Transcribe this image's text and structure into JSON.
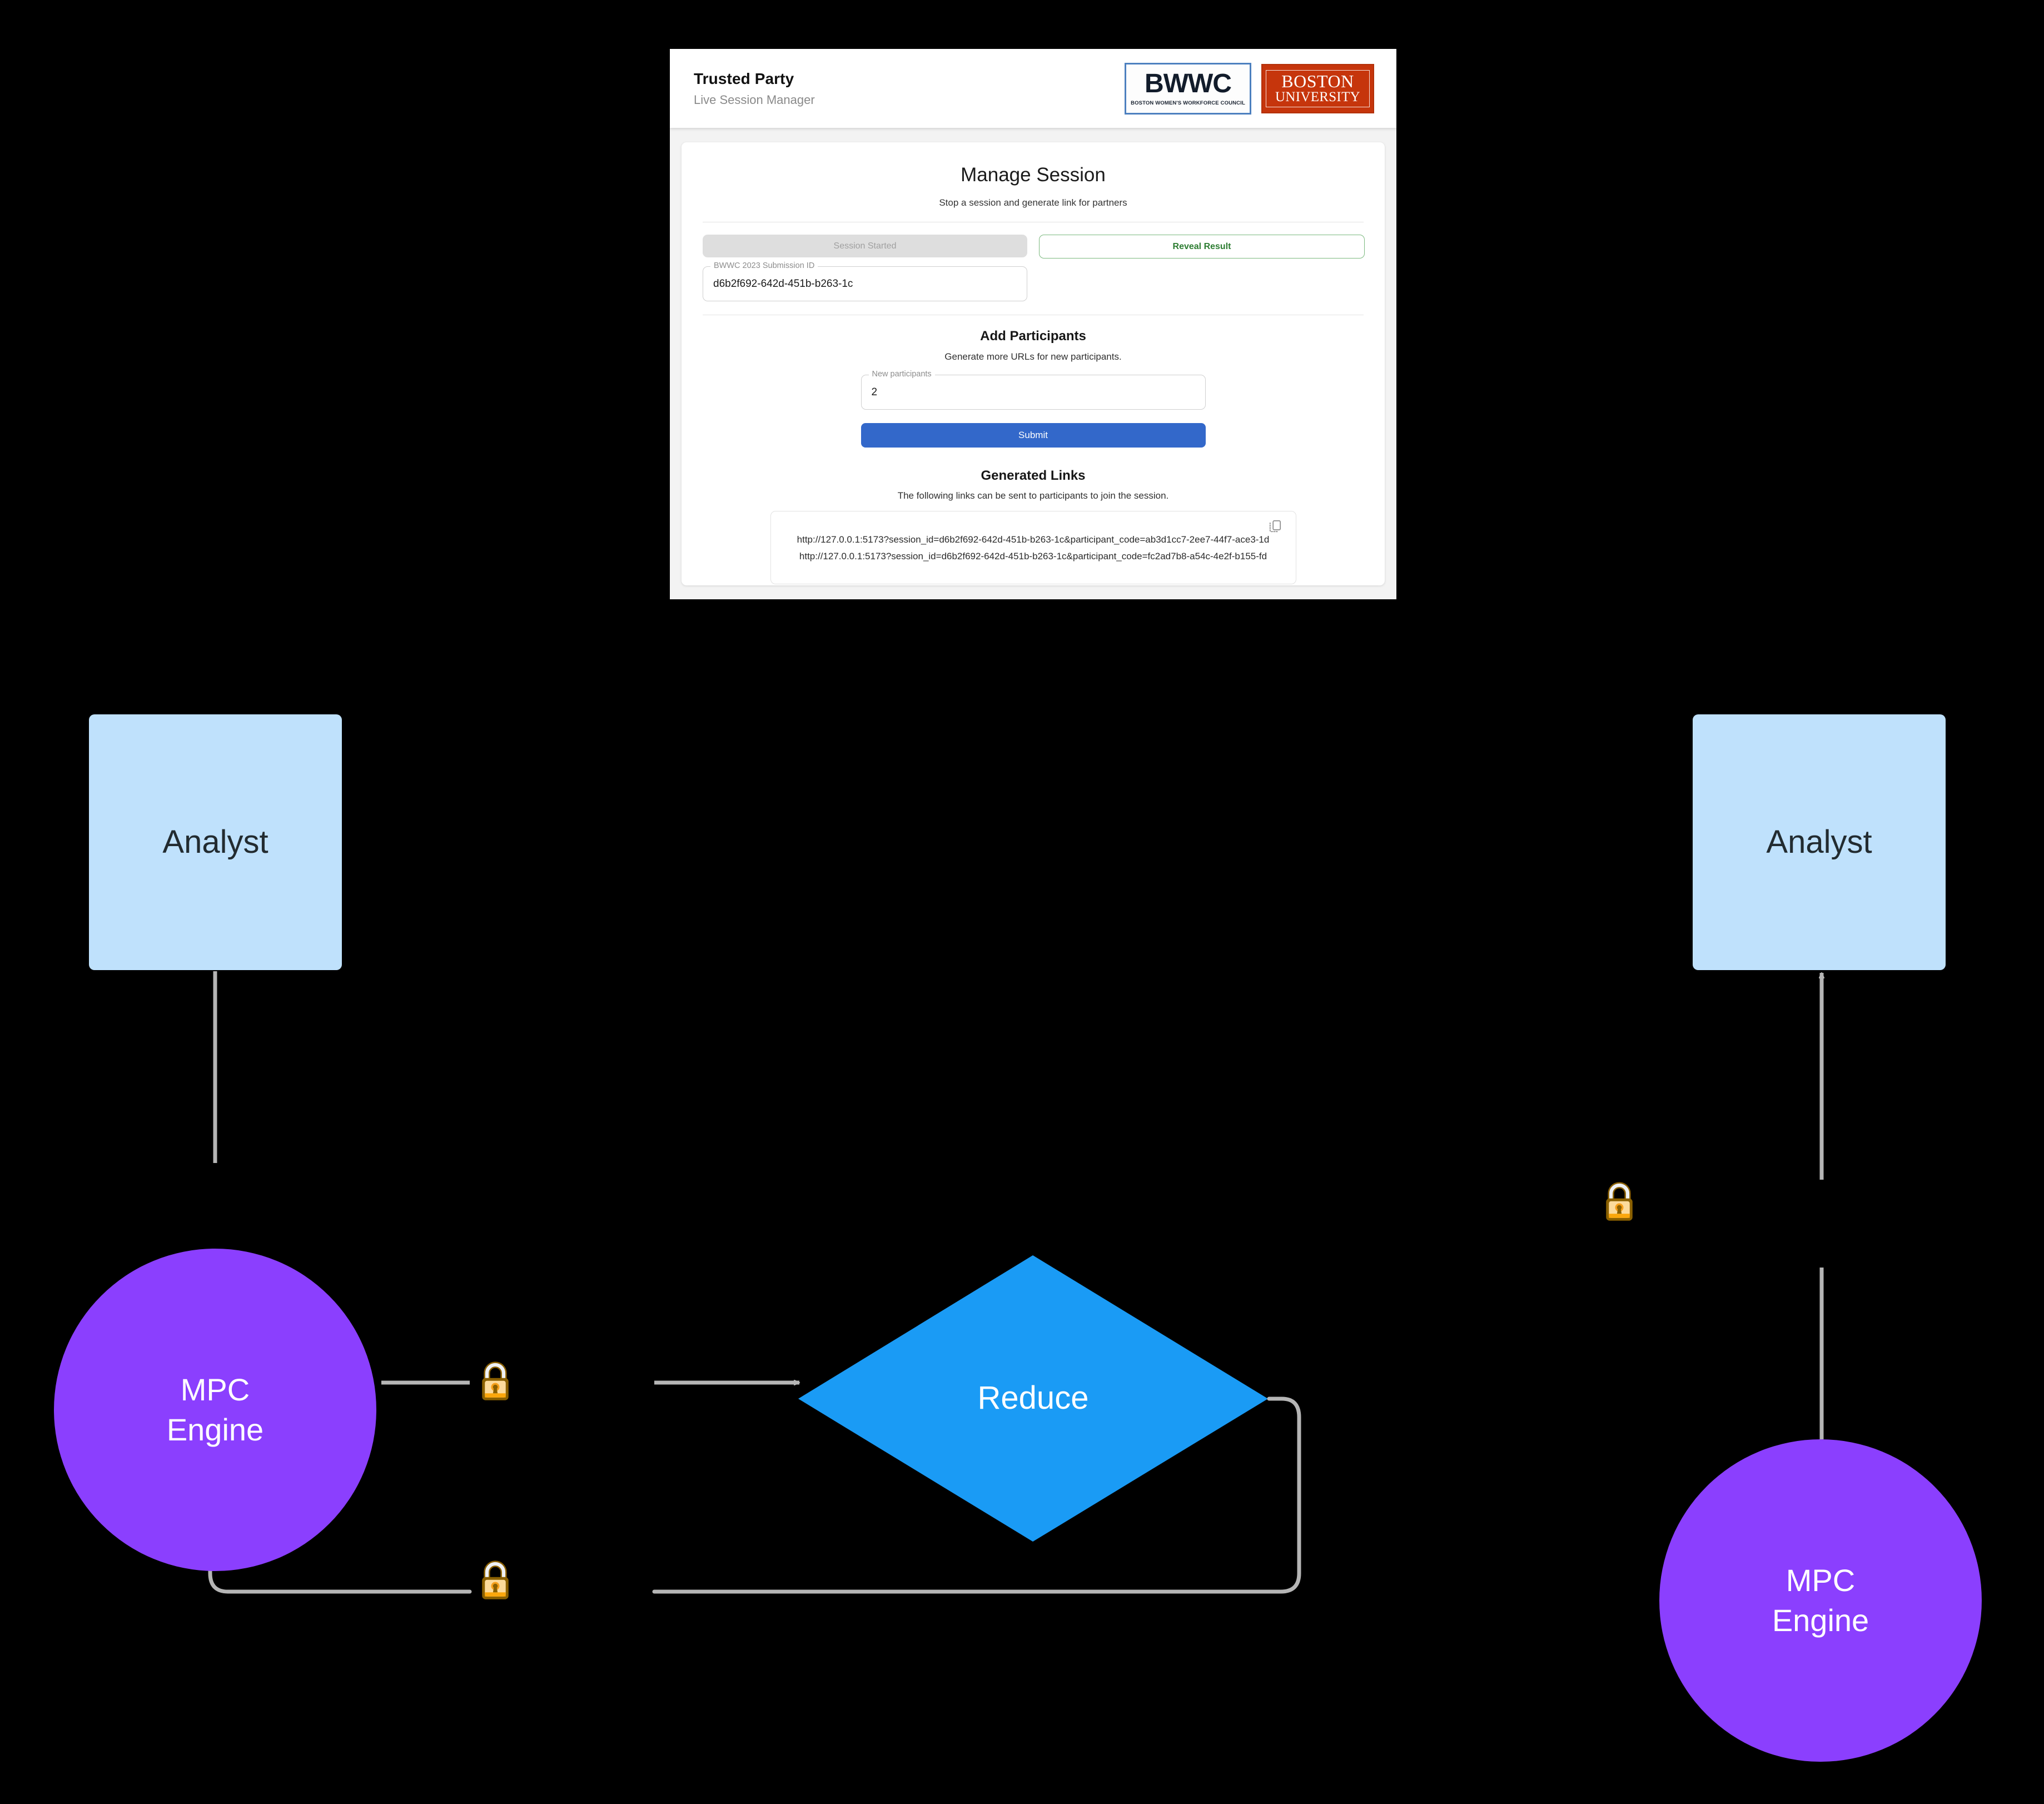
{
  "app": {
    "header": {
      "title": "Trusted Party",
      "subtitle": "Live Session Manager",
      "bwwc_logo": {
        "wordmark": "BWWC",
        "tagline": "BOSTON WOMEN'S WORKFORCE COUNCIL",
        "border_color": "#4d80bf"
      },
      "bu_logo": {
        "line1": "BOSTON",
        "line2": "UNIVERSITY",
        "background_color": "#c6350c"
      }
    },
    "manage_session": {
      "title": "Manage Session",
      "subtitle": "Stop a session and generate link for partners",
      "session_started_button": "Session Started",
      "reveal_result_button": "Reveal Result",
      "submission_id_label": "BWWC 2023 Submission ID",
      "submission_id_value": "d6b2f692-642d-451b-b263-1c"
    },
    "add_participants": {
      "title": "Add Participants",
      "subtitle": "Generate more URLs for new participants.",
      "new_participants_label": "New participants",
      "new_participants_value": "2",
      "submit_button": "Submit"
    },
    "generated_links": {
      "title": "Generated Links",
      "subtitle": "The following links can be sent to participants to join the session.",
      "copy_icon": "copy-icon",
      "links": [
        "http://127.0.0.1:5173?session_id=d6b2f692-642d-451b-b263-1c&participant_code=ab3d1cc7-2ee7-44f7-ace3-1d",
        "http://127.0.0.1:5173?session_id=d6b2f692-642d-451b-b263-1c&participant_code=fc2ad7b8-a54c-4e2f-b155-fd"
      ]
    }
  },
  "diagram": {
    "nodes": {
      "analyst_left": "Analyst",
      "analyst_right": "Analyst",
      "mpc_left": "MPC\nEngine",
      "mpc_left_line1": "MPC",
      "mpc_left_line2": "Engine",
      "mpc_right_line1": "MPC",
      "mpc_right_line2": "Engine",
      "reduce": "Reduce"
    },
    "icons": {
      "lock_send": "lock-icon",
      "lock_return": "lock-icon",
      "lock_right": "lock-icon"
    },
    "colors": {
      "analyst_fill": "#bfe1fc",
      "mpc_fill": "#8b3ffe",
      "reduce_fill": "#1a9bf5",
      "connector": "#b5b5b5",
      "background": "#000000"
    }
  }
}
